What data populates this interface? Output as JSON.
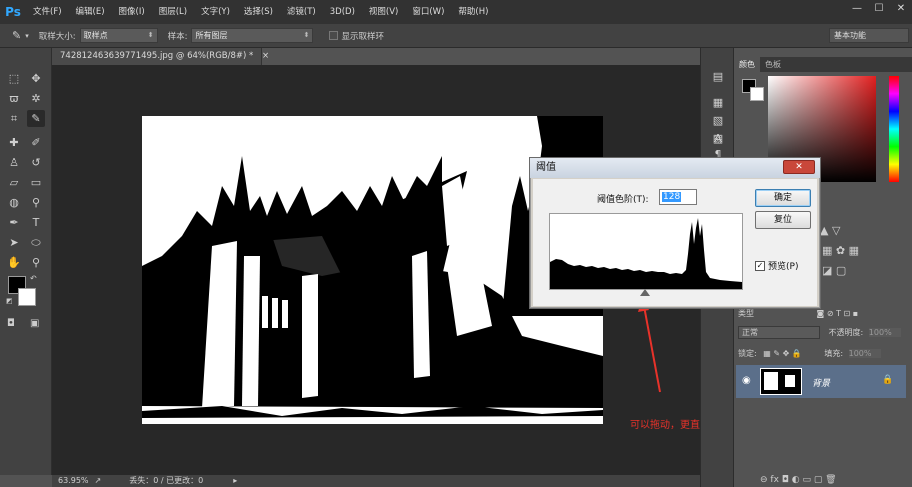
{
  "menubar": {
    "logo": "Ps",
    "items": [
      "文件(F)",
      "编辑(E)",
      "图像(I)",
      "图层(L)",
      "文字(Y)",
      "选择(S)",
      "滤镜(T)",
      "3D(D)",
      "视图(V)",
      "窗口(W)",
      "帮助(H)"
    ],
    "window_controls": [
      "—",
      "☐",
      "✕"
    ]
  },
  "options": {
    "sample_size_label": "取样大小:",
    "sample_size_value": "取样点",
    "sample_label": "样本:",
    "sample_value": "所有图层",
    "show_ring_label": "显示取样环",
    "workspace": "基本功能"
  },
  "document": {
    "tab_title": "742812463639771495.jpg @ 64%(RGB/8#) *",
    "tab_close": "×"
  },
  "statusbar": {
    "zoom": "63.95%",
    "info": "丢失：0 / 已更改：0"
  },
  "annotation": {
    "text": "可以拖动，更直观"
  },
  "color_panel": {
    "tabs": [
      "颜色",
      "色板"
    ]
  },
  "layers_panel": {
    "kind_label": "类型",
    "blend_mode": "正常",
    "opacity_label": "不透明度:",
    "opacity_value": "100%",
    "lock_label": "锁定:",
    "fill_label": "填充:",
    "fill_value": "100%",
    "layer_name": "背景"
  },
  "dialog": {
    "title": "阈值",
    "close": "✕",
    "threshold_label": "阈值色阶(T):",
    "threshold_value": "128",
    "ok_label": "确定",
    "reset_label": "复位",
    "preview_label": "预览(P)",
    "preview_checked": "✓"
  },
  "colors": {
    "accent": "#31a8ff",
    "annotation": "#e8322a",
    "layer_selected": "#5b6f8a"
  }
}
